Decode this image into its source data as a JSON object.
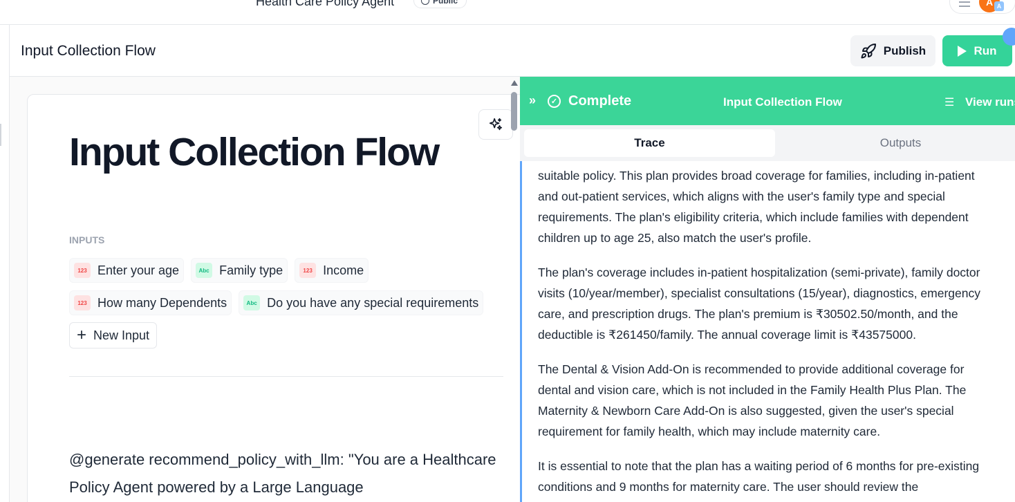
{
  "topbar": {
    "agent_name": "Health Care Policy Agent",
    "visibility": "Public",
    "avatar_letter": "A",
    "avatar_badge": "A"
  },
  "header": {
    "title": "Input Collection Flow",
    "publish_label": "Publish",
    "run_label": "Run"
  },
  "editor": {
    "doc_title": "Input Collection Flow",
    "inputs_heading": "INPUTS",
    "inputs": [
      {
        "label": "Enter your age",
        "type": "123"
      },
      {
        "label": "Family type",
        "type": "Abc"
      },
      {
        "label": "Income",
        "type": "123"
      },
      {
        "label": "How many Dependents",
        "type": "123"
      },
      {
        "label": "Do you have any special requirements",
        "type": "Abc"
      }
    ],
    "new_input_label": "New Input",
    "prompt_text": "@generate recommend_policy_with_llm: \"You are a Healthcare Policy Agent powered by a Large Language"
  },
  "run_panel": {
    "status": "Complete",
    "flow_name": "Input Collection Flow",
    "view_runs_label": "View runs",
    "tabs": [
      "Trace",
      "Outputs"
    ],
    "active_tab": "Trace",
    "paragraphs": [
      "suitable policy. This plan provides broad coverage for families, including in-patient and out-patient services, which aligns with the user's family type and special requirements. The plan's eligibility criteria, which include families with dependent children up to age 25, also match the user's profile.",
      "The plan's coverage includes in-patient hospitalization (semi-private), family doctor visits (10/year/member), specialist consultations (15/year), diagnostics, emergency care, and prescription drugs. The plan's premium is ₹30502.50/month, and the deductible is ₹261450/family. The annual coverage limit is ₹43575000.",
      "The Dental & Vision Add-On is recommended to provide additional coverage for dental and vision care, which is not included in the Family Health Plus Plan. The Maternity & Newborn Care Add-On is also suggested, given the user's special requirement for family health, which may include maternity care.",
      "It is essential to note that the plan has a waiting period of 6 months for pre-existing conditions and 9 months for maternity care. The user should review the"
    ]
  },
  "colors": {
    "accent_green": "#34d399",
    "trace_border": "#60a5fa",
    "avatar": "#f97316"
  }
}
